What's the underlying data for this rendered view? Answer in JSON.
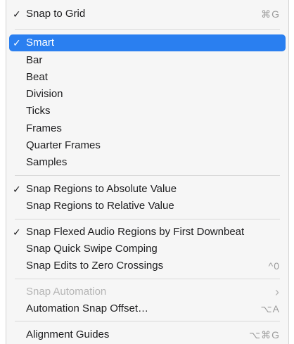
{
  "menu": {
    "snap_to_grid": {
      "check": "✓",
      "label": "Snap to Grid",
      "shortcut": "⌘G"
    },
    "grid_modes": [
      {
        "check": "✓",
        "label": "Smart"
      },
      {
        "check": "",
        "label": "Bar"
      },
      {
        "check": "",
        "label": "Beat"
      },
      {
        "check": "",
        "label": "Division"
      },
      {
        "check": "",
        "label": "Ticks"
      },
      {
        "check": "",
        "label": "Frames"
      },
      {
        "check": "",
        "label": "Quarter Frames"
      },
      {
        "check": "",
        "label": "Samples"
      }
    ],
    "snap_absolute": {
      "check": "✓",
      "label": "Snap Regions to Absolute Value"
    },
    "snap_relative": {
      "label": "Snap Regions to Relative Value"
    },
    "snap_flexed": {
      "check": "✓",
      "label": "Snap Flexed Audio Regions by First Downbeat"
    },
    "snap_quick_swipe": {
      "label": "Snap Quick Swipe Comping"
    },
    "snap_edits_zero": {
      "label": "Snap Edits to Zero Crossings",
      "shortcut": "^0"
    },
    "snap_automation": {
      "label": "Snap Automation",
      "submenu_indicator": "›"
    },
    "automation_snap_offset": {
      "label": "Automation Snap Offset…",
      "shortcut": "⌥A"
    },
    "alignment_guides": {
      "label": "Alignment Guides",
      "shortcut": "⌥⌘G"
    }
  },
  "colors": {
    "selection": "#2a7ff0",
    "text": "#1d1d1f",
    "disabled_text": "#b5b5b5",
    "shortcut_text": "#9b9b9b",
    "menu_background": "#f6f6f6"
  }
}
